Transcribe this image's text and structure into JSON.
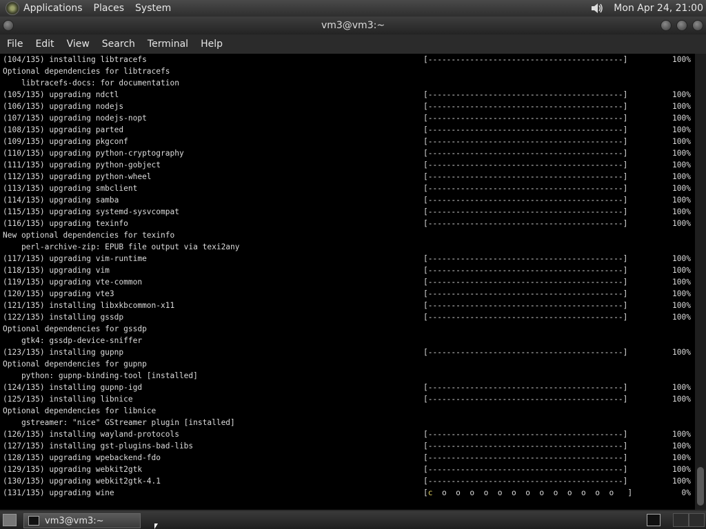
{
  "top_panel": {
    "menus": [
      "Applications",
      "Places",
      "System"
    ],
    "clock": "Mon Apr 24, 21:00"
  },
  "window": {
    "title": "vm3@vm3:~"
  },
  "menubar": [
    "File",
    "Edit",
    "View",
    "Search",
    "Terminal",
    "Help"
  ],
  "terminal": {
    "lines": [
      {
        "text": "(104/135) installing libtracefs",
        "bar": "[------------------------------------------]",
        "pct": "100%"
      },
      {
        "text": "Optional dependencies for libtracefs"
      },
      {
        "text": "    libtracefs-docs: for documentation"
      },
      {
        "text": "(105/135) upgrading ndctl",
        "bar": "[------------------------------------------]",
        "pct": "100%"
      },
      {
        "text": "(106/135) upgrading nodejs",
        "bar": "[------------------------------------------]",
        "pct": "100%"
      },
      {
        "text": "(107/135) upgrading nodejs-nopt",
        "bar": "[------------------------------------------]",
        "pct": "100%"
      },
      {
        "text": "(108/135) upgrading parted",
        "bar": "[------------------------------------------]",
        "pct": "100%"
      },
      {
        "text": "(109/135) upgrading pkgconf",
        "bar": "[------------------------------------------]",
        "pct": "100%"
      },
      {
        "text": "(110/135) upgrading python-cryptography",
        "bar": "[------------------------------------------]",
        "pct": "100%"
      },
      {
        "text": "(111/135) upgrading python-gobject",
        "bar": "[------------------------------------------]",
        "pct": "100%"
      },
      {
        "text": "(112/135) upgrading python-wheel",
        "bar": "[------------------------------------------]",
        "pct": "100%"
      },
      {
        "text": "(113/135) upgrading smbclient",
        "bar": "[------------------------------------------]",
        "pct": "100%"
      },
      {
        "text": "(114/135) upgrading samba",
        "bar": "[------------------------------------------]",
        "pct": "100%"
      },
      {
        "text": "(115/135) upgrading systemd-sysvcompat",
        "bar": "[------------------------------------------]",
        "pct": "100%"
      },
      {
        "text": "(116/135) upgrading texinfo",
        "bar": "[------------------------------------------]",
        "pct": "100%"
      },
      {
        "text": "New optional dependencies for texinfo"
      },
      {
        "text": "    perl-archive-zip: EPUB file output via texi2any"
      },
      {
        "text": "(117/135) upgrading vim-runtime",
        "bar": "[------------------------------------------]",
        "pct": "100%"
      },
      {
        "text": "(118/135) upgrading vim",
        "bar": "[------------------------------------------]",
        "pct": "100%"
      },
      {
        "text": "(119/135) upgrading vte-common",
        "bar": "[------------------------------------------]",
        "pct": "100%"
      },
      {
        "text": "(120/135) upgrading vte3",
        "bar": "[------------------------------------------]",
        "pct": "100%"
      },
      {
        "text": "(121/135) installing libxkbcommon-x11",
        "bar": "[------------------------------------------]",
        "pct": "100%"
      },
      {
        "text": "(122/135) installing gssdp",
        "bar": "[------------------------------------------]",
        "pct": "100%"
      },
      {
        "text": "Optional dependencies for gssdp"
      },
      {
        "text": "    gtk4: gssdp-device-sniffer"
      },
      {
        "text": "(123/135) installing gupnp",
        "bar": "[------------------------------------------]",
        "pct": "100%"
      },
      {
        "text": "Optional dependencies for gupnp"
      },
      {
        "text": "    python: gupnp-binding-tool [installed]"
      },
      {
        "text": "(124/135) installing gupnp-igd",
        "bar": "[------------------------------------------]",
        "pct": "100%"
      },
      {
        "text": "(125/135) installing libnice",
        "bar": "[------------------------------------------]",
        "pct": "100%"
      },
      {
        "text": "Optional dependencies for libnice"
      },
      {
        "text": "    gstreamer: \"nice\" GStreamer plugin [installed]"
      },
      {
        "text": "(126/135) installing wayland-protocols",
        "bar": "[------------------------------------------]",
        "pct": "100%"
      },
      {
        "text": "(127/135) installing gst-plugins-bad-libs",
        "bar": "[------------------------------------------]",
        "pct": "100%"
      },
      {
        "text": "(128/135) upgrading wpebackend-fdo",
        "bar": "[------------------------------------------]",
        "pct": "100%"
      },
      {
        "text": "(129/135) upgrading webkit2gtk",
        "bar": "[------------------------------------------]",
        "pct": "100%"
      },
      {
        "text": "(130/135) upgrading webkit2gtk-4.1",
        "bar": "[------------------------------------------]",
        "pct": "100%"
      },
      {
        "text": "(131/135) upgrading wine",
        "bar": "[c  o  o  o  o  o  o  o  o  o  o  o  o  o   ]",
        "pct": "0%",
        "waiting": true
      }
    ]
  },
  "taskbar": {
    "task_label": "vm3@vm3:~"
  }
}
